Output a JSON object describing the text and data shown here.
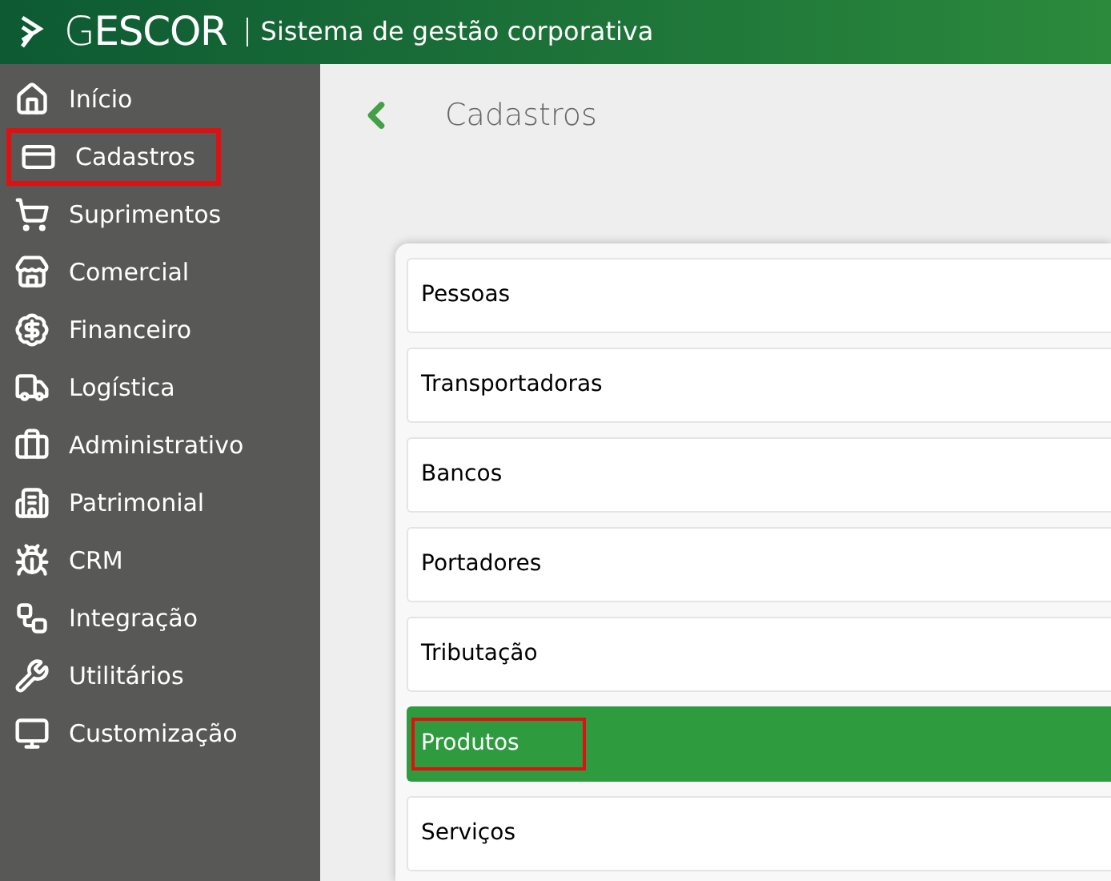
{
  "header": {
    "logo": "G**ESCOR**",
    "subtitle": "Sistema de gestão corporativa"
  },
  "sidebar": {
    "items": [
      {
        "label": "Início",
        "highlighted": false
      },
      {
        "label": "Cadastros",
        "highlighted": true
      },
      {
        "label": "Suprimentos",
        "highlighted": false
      },
      {
        "label": "Comercial",
        "highlighted": false
      },
      {
        "label": "Financeiro",
        "highlighted": false
      },
      {
        "label": "Logística",
        "highlighted": false
      },
      {
        "label": "Administrativo",
        "highlighted": false
      },
      {
        "label": "Patrimonial",
        "highlighted": false
      },
      {
        "label": "CRM",
        "highlighted": false
      },
      {
        "label": "Integração",
        "highlighted": false
      },
      {
        "label": "Utilitários",
        "highlighted": false
      },
      {
        "label": "Customização",
        "highlighted": false
      }
    ]
  },
  "page": {
    "title": "Cadastros"
  },
  "list": [
    {
      "label": "Pessoas",
      "selected": false,
      "highlighted": false
    },
    {
      "label": "Transportadoras",
      "selected": false,
      "highlighted": false
    },
    {
      "label": "Bancos",
      "selected": false,
      "highlighted": false
    },
    {
      "label": "Portadores",
      "selected": false,
      "highlighted": false
    },
    {
      "label": "Tributação",
      "selected": false,
      "highlighted": false
    },
    {
      "label": "Produtos",
      "selected": true,
      "highlighted": true
    },
    {
      "label": "Serviços",
      "selected": false,
      "highlighted": false
    }
  ]
}
